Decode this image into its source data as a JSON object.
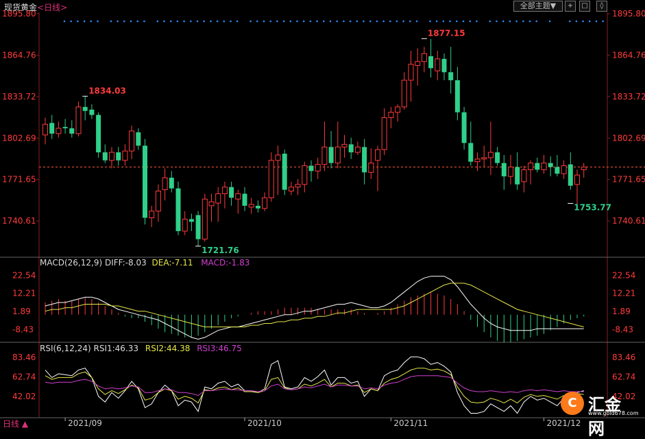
{
  "header": {
    "title": "现货黄金",
    "timeframe": "<日线>",
    "theme_button": "全部主题▼",
    "icons": [
      "crosshair-icon",
      "expand-icon",
      "settings-icon"
    ]
  },
  "footer": {
    "timeframe_selector": "日线 ▲"
  },
  "logo": {
    "symbol": "C",
    "name": "汇金网",
    "url": "www.gold678.com"
  },
  "colors": {
    "up": "#ff3b3b",
    "down": "#2fd08a",
    "axis_text": "#ff3b3b",
    "grid": "#444444",
    "diff": "#ffffff",
    "dea": "#e8e84a",
    "macd": "#d040d0",
    "rsi1": "#ffffff",
    "rsi2": "#e8e84a",
    "rsi3": "#d040d0",
    "marker_dots": "#2d8cff"
  },
  "chart_data": [
    {
      "type": "candlestick",
      "name": "price",
      "y_ticks": [
        "1895.80",
        "1864.76",
        "1833.72",
        "1802.69",
        "1771.65",
        "1740.61"
      ],
      "ylim": [
        1715,
        1895.8
      ],
      "x_labels": [
        {
          "label": "2021/09",
          "index": 3
        },
        {
          "label": "2021/10",
          "index": 30
        },
        {
          "label": "2021/11",
          "index": 52
        },
        {
          "label": "2021/12",
          "index": 75
        }
      ],
      "last_price": 1781,
      "annotations": [
        {
          "label": "1834.03",
          "index": 6,
          "value": 1834.03,
          "kind": "high"
        },
        {
          "label": "1877.15",
          "index": 57,
          "value": 1877.15,
          "kind": "high"
        },
        {
          "label": "1721.76",
          "index": 23,
          "value": 1721.76,
          "kind": "low"
        },
        {
          "label": "1753.77",
          "index": 79,
          "value": 1753.77,
          "kind": "low"
        }
      ],
      "ohlc": [
        [
          1805,
          1818,
          1798,
          1813
        ],
        [
          1814,
          1820,
          1802,
          1806
        ],
        [
          1806,
          1815,
          1803,
          1810
        ],
        [
          1811,
          1817,
          1806,
          1810
        ],
        [
          1810,
          1816,
          1803,
          1806
        ],
        [
          1806,
          1830,
          1804,
          1826
        ],
        [
          1826,
          1834,
          1816,
          1823
        ],
        [
          1824,
          1828,
          1817,
          1820
        ],
        [
          1820,
          1822,
          1788,
          1792
        ],
        [
          1792,
          1798,
          1784,
          1786
        ],
        [
          1786,
          1796,
          1780,
          1792
        ],
        [
          1792,
          1796,
          1782,
          1786
        ],
        [
          1786,
          1798,
          1782,
          1793
        ],
        [
          1793,
          1812,
          1787,
          1808
        ],
        [
          1807,
          1810,
          1794,
          1797
        ],
        [
          1797,
          1802,
          1738,
          1743
        ],
        [
          1743,
          1752,
          1736,
          1748
        ],
        [
          1748,
          1768,
          1740,
          1763
        ],
        [
          1764,
          1780,
          1756,
          1773
        ],
        [
          1773,
          1778,
          1762,
          1765
        ],
        [
          1765,
          1770,
          1730,
          1733
        ],
        [
          1733,
          1748,
          1730,
          1742
        ],
        [
          1742,
          1746,
          1733,
          1740
        ],
        [
          1745,
          1748,
          1722,
          1727
        ],
        [
          1727,
          1761,
          1725,
          1757
        ],
        [
          1752,
          1761,
          1740,
          1755
        ],
        [
          1754,
          1766,
          1740,
          1761
        ],
        [
          1761,
          1770,
          1750,
          1766
        ],
        [
          1766,
          1770,
          1752,
          1758
        ],
        [
          1757,
          1764,
          1746,
          1761
        ],
        [
          1761,
          1766,
          1748,
          1752
        ],
        [
          1751,
          1758,
          1746,
          1753
        ],
        [
          1752,
          1756,
          1747,
          1750
        ],
        [
          1750,
          1762,
          1748,
          1758
        ],
        [
          1758,
          1792,
          1755,
          1786
        ],
        [
          1786,
          1797,
          1760,
          1790
        ],
        [
          1791,
          1794,
          1760,
          1764
        ],
        [
          1763,
          1770,
          1760,
          1766
        ],
        [
          1766,
          1772,
          1760,
          1768
        ],
        [
          1768,
          1785,
          1762,
          1782
        ],
        [
          1782,
          1786,
          1770,
          1778
        ],
        [
          1778,
          1788,
          1772,
          1783
        ],
        [
          1783,
          1815,
          1778,
          1796
        ],
        [
          1796,
          1808,
          1780,
          1784
        ],
        [
          1784,
          1815,
          1780,
          1796
        ],
        [
          1796,
          1805,
          1788,
          1798
        ],
        [
          1798,
          1803,
          1787,
          1792
        ],
        [
          1792,
          1800,
          1790,
          1796
        ],
        [
          1796,
          1802,
          1768,
          1777
        ],
        [
          1777,
          1795,
          1772,
          1784
        ],
        [
          1786,
          1797,
          1763,
          1794
        ],
        [
          1794,
          1825,
          1790,
          1818
        ],
        [
          1818,
          1826,
          1810,
          1822
        ],
        [
          1822,
          1828,
          1815,
          1826
        ],
        [
          1826,
          1852,
          1824,
          1846
        ],
        [
          1846,
          1868,
          1830,
          1858
        ],
        [
          1857,
          1870,
          1842,
          1860
        ],
        [
          1860,
          1871,
          1852,
          1866
        ],
        [
          1864,
          1877,
          1848,
          1855
        ],
        [
          1853,
          1868,
          1846,
          1862
        ],
        [
          1862,
          1866,
          1846,
          1852
        ],
        [
          1852,
          1871,
          1836,
          1846
        ],
        [
          1846,
          1856,
          1816,
          1822
        ],
        [
          1822,
          1826,
          1794,
          1799
        ],
        [
          1799,
          1815,
          1782,
          1785
        ],
        [
          1785,
          1792,
          1778,
          1787
        ],
        [
          1787,
          1797,
          1781,
          1788
        ],
        [
          1788,
          1815,
          1775,
          1792
        ],
        [
          1792,
          1796,
          1782,
          1784
        ],
        [
          1784,
          1790,
          1764,
          1774
        ],
        [
          1774,
          1790,
          1768,
          1781
        ],
        [
          1781,
          1792,
          1764,
          1768
        ],
        [
          1770,
          1782,
          1762,
          1779
        ],
        [
          1779,
          1786,
          1768,
          1784
        ],
        [
          1784,
          1788,
          1777,
          1779
        ],
        [
          1779,
          1790,
          1776,
          1784
        ],
        [
          1784,
          1789,
          1774,
          1781
        ],
        [
          1781,
          1790,
          1774,
          1776
        ],
        [
          1776,
          1786,
          1772,
          1782
        ],
        [
          1783,
          1792,
          1764,
          1767
        ],
        [
          1768,
          1779,
          1753,
          1775
        ],
        [
          1779,
          1784,
          1773,
          1781
        ]
      ]
    },
    {
      "type": "bar+line",
      "name": "macd",
      "label": "MACD(26,12,9)",
      "diff_label": "DIFF:-8.03",
      "dea_label": "DEA:-7.11",
      "macd_label": "MACD:-1.83",
      "y_ticks": [
        "22.54",
        "12.21",
        "1.89",
        "-8.43"
      ],
      "ylim": [
        -15,
        27
      ],
      "histogram": [
        7,
        8,
        9,
        8,
        8,
        9,
        10,
        9,
        7,
        5,
        3,
        1,
        -1,
        -2,
        -2,
        -4,
        -6,
        -8,
        -10,
        -11,
        -12,
        -13,
        -13,
        -12,
        -10,
        -8,
        -6,
        -4,
        -2,
        -1,
        0,
        1,
        2,
        2,
        2,
        3,
        4,
        4,
        4,
        4,
        4,
        3,
        3,
        3,
        3,
        3,
        3,
        2,
        1,
        0,
        1,
        2,
        4,
        6,
        8,
        10,
        11,
        12,
        13,
        12,
        11,
        9,
        6,
        2,
        -3,
        -7,
        -10,
        -13,
        -15,
        -16,
        -16,
        -15,
        -14,
        -13,
        -12,
        -11,
        -9,
        -7,
        -5,
        -3,
        -2,
        -1
      ],
      "diff": [
        5,
        6,
        7,
        7,
        8,
        9,
        10,
        10,
        9,
        7,
        5,
        3,
        2,
        1,
        0,
        -1,
        -2,
        -3,
        -5,
        -7,
        -9,
        -11,
        -13,
        -14,
        -13,
        -11,
        -9,
        -8,
        -7,
        -7,
        -6,
        -5,
        -4,
        -3,
        -2,
        -1,
        0,
        0,
        1,
        2,
        2,
        3,
        4,
        5,
        6,
        6,
        7,
        6,
        5,
        4,
        4,
        5,
        7,
        10,
        13,
        16,
        19,
        21,
        22,
        22,
        22,
        20,
        16,
        11,
        6,
        2,
        -2,
        -5,
        -7,
        -8,
        -9,
        -9,
        -9,
        -9,
        -8,
        -8,
        -8,
        -8,
        -8,
        -8,
        -8,
        -8
      ],
      "dea": [
        2,
        3,
        3,
        4,
        4,
        5,
        6,
        6,
        6,
        6,
        5,
        5,
        4,
        3,
        2,
        2,
        1,
        0,
        -1,
        -2,
        -3,
        -4,
        -5,
        -6,
        -7,
        -7,
        -7,
        -7,
        -7,
        -7,
        -7,
        -6,
        -6,
        -5,
        -5,
        -4,
        -4,
        -3,
        -3,
        -2,
        -2,
        -1,
        -1,
        0,
        1,
        1,
        2,
        3,
        3,
        3,
        3,
        3,
        3,
        4,
        5,
        7,
        9,
        11,
        13,
        15,
        17,
        18,
        18,
        18,
        17,
        15,
        13,
        11,
        9,
        7,
        5,
        3,
        2,
        1,
        0,
        -1,
        -2,
        -3,
        -4,
        -5,
        -6,
        -7
      ]
    },
    {
      "type": "line",
      "name": "rsi",
      "label": "RSI(6,12,24)",
      "rsi1_label": "RSI1:46.33",
      "rsi2_label": "RSI2:44.38",
      "rsi3_label": "RSI3:46.75",
      "y_ticks": [
        "83.46",
        "62.74",
        "42.02"
      ],
      "ylim": [
        20,
        90
      ],
      "rsi1": [
        70,
        62,
        66,
        65,
        64,
        70,
        72,
        62,
        42,
        36,
        46,
        40,
        48,
        58,
        50,
        30,
        34,
        46,
        54,
        48,
        32,
        38,
        36,
        26,
        52,
        50,
        56,
        58,
        52,
        55,
        48,
        48,
        46,
        50,
        76,
        80,
        52,
        50,
        52,
        62,
        58,
        63,
        70,
        54,
        62,
        62,
        56,
        58,
        42,
        50,
        48,
        64,
        68,
        70,
        78,
        84,
        84,
        82,
        76,
        78,
        74,
        68,
        46,
        32,
        24,
        24,
        26,
        34,
        30,
        26,
        32,
        24,
        36,
        42,
        38,
        40,
        36,
        32,
        40,
        34,
        46,
        48
      ],
      "rsi2": [
        64,
        60,
        62,
        62,
        62,
        66,
        68,
        62,
        50,
        44,
        48,
        45,
        49,
        54,
        51,
        38,
        40,
        46,
        50,
        48,
        39,
        42,
        40,
        35,
        49,
        48,
        51,
        52,
        49,
        51,
        47,
        47,
        46,
        48,
        60,
        62,
        51,
        49,
        50,
        55,
        53,
        56,
        60,
        52,
        56,
        56,
        53,
        54,
        46,
        50,
        48,
        56,
        60,
        62,
        66,
        70,
        72,
        72,
        70,
        71,
        69,
        65,
        52,
        42,
        36,
        35,
        36,
        40,
        38,
        35,
        39,
        35,
        41,
        44,
        42,
        43,
        41,
        39,
        43,
        40,
        45,
        44
      ],
      "rsi3": [
        57,
        56,
        57,
        57,
        57,
        59,
        60,
        58,
        53,
        50,
        51,
        50,
        51,
        53,
        52,
        46,
        46,
        48,
        50,
        49,
        46,
        46,
        45,
        43,
        48,
        48,
        49,
        50,
        49,
        49,
        48,
        48,
        47,
        48,
        53,
        55,
        50,
        49,
        50,
        52,
        51,
        53,
        55,
        52,
        54,
        54,
        53,
        53,
        50,
        51,
        50,
        54,
        56,
        57,
        60,
        63,
        64,
        64,
        64,
        64,
        63,
        62,
        56,
        51,
        48,
        47,
        47,
        48,
        47,
        46,
        47,
        46,
        48,
        49,
        48,
        49,
        48,
        47,
        48,
        47,
        47,
        47
      ]
    }
  ]
}
